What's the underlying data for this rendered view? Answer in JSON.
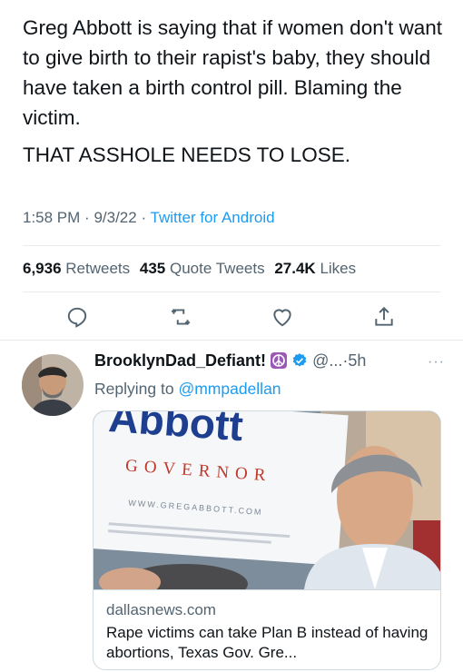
{
  "tweet": {
    "text_main": "Greg Abbott is saying that if women don't want to give birth to their rapist's baby, they should have taken a birth control pill. Blaming the victim.",
    "text_caps": "THAT ASSHOLE NEEDS TO LOSE.",
    "time": "1:58 PM",
    "date": "9/3/22",
    "separator": "·",
    "client": "Twitter for Android"
  },
  "stats": {
    "retweets_count": "6,936",
    "retweets_label": "Retweets",
    "quotes_count": "435",
    "quotes_label": "Quote Tweets",
    "likes_count": "27.4K",
    "likes_label": "Likes"
  },
  "actions": [
    "reply-icon",
    "retweet-icon",
    "like-icon",
    "share-icon"
  ],
  "reply": {
    "display_name": "BrooklynDad_Defiant!",
    "handle": "@...",
    "separator": "·",
    "time": "5h",
    "more": "···",
    "replying_to_label": "Replying to",
    "replying_to_handle": "@mmpadellan"
  },
  "card": {
    "image_sign_word": "Abbott",
    "image_sign_sub": "GOVERNOR",
    "image_sign_url": "WWW.GREGABBOTT.COM",
    "domain": "dallasnews.com",
    "title": "Rape victims can take Plan B instead of having abortions, Texas Gov. Gre..."
  },
  "colors": {
    "text": "#0f1419",
    "secondary": "#536471",
    "link": "#1d9bf0",
    "sign_blue": "#1e3f8f",
    "sign_red": "#c0392b"
  }
}
